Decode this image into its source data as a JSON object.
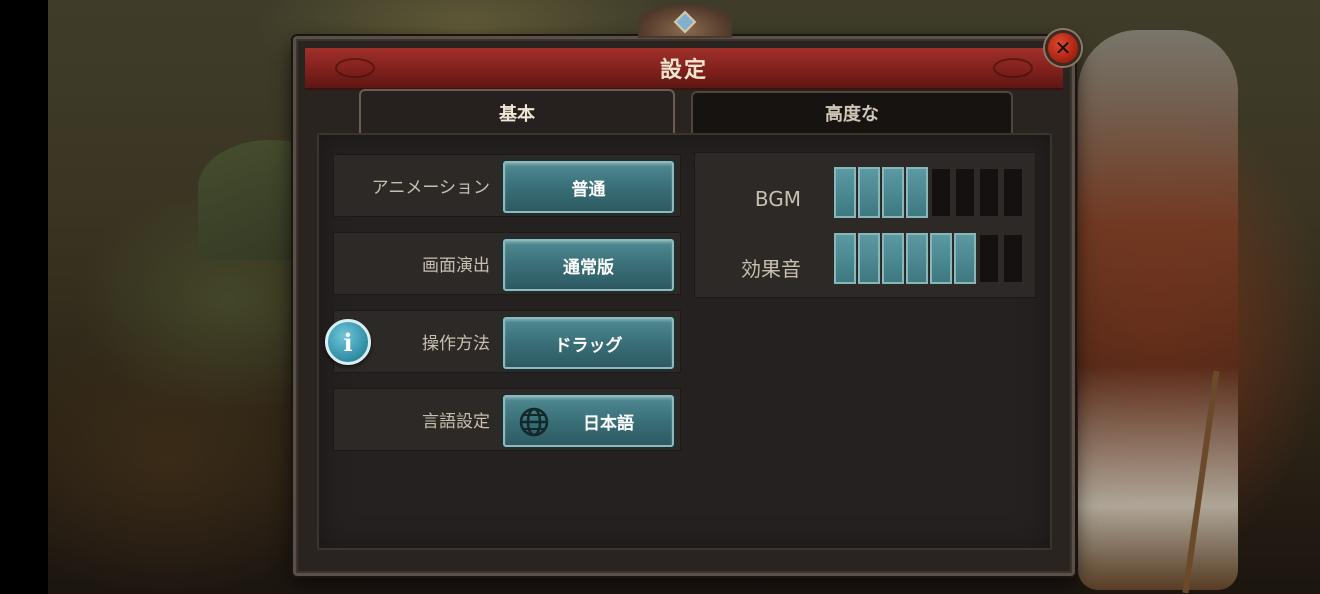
{
  "window": {
    "title": "設定",
    "close_icon": "close-icon"
  },
  "tabs": [
    {
      "label": "基本",
      "active": true
    },
    {
      "label": "高度な",
      "active": false
    }
  ],
  "settings": [
    {
      "label": "アニメーション",
      "value": "普通"
    },
    {
      "label": "画面演出",
      "value": "通常版"
    },
    {
      "label": "操作方法",
      "value": "ドラッグ",
      "info_icon": "info-icon",
      "info_text": "i"
    },
    {
      "label": "言語設定",
      "value": "日本語",
      "icon": "globe-icon"
    }
  ],
  "audio": {
    "bgm": {
      "label": "BGM",
      "level": 4,
      "max": 8
    },
    "sfx": {
      "label": "効果音",
      "level": 6,
      "max": 8
    }
  },
  "colors": {
    "accent": "#3a6f78",
    "title_bar": "#7e1f1b",
    "close": "#c0301a",
    "info": "#2b87a0"
  }
}
